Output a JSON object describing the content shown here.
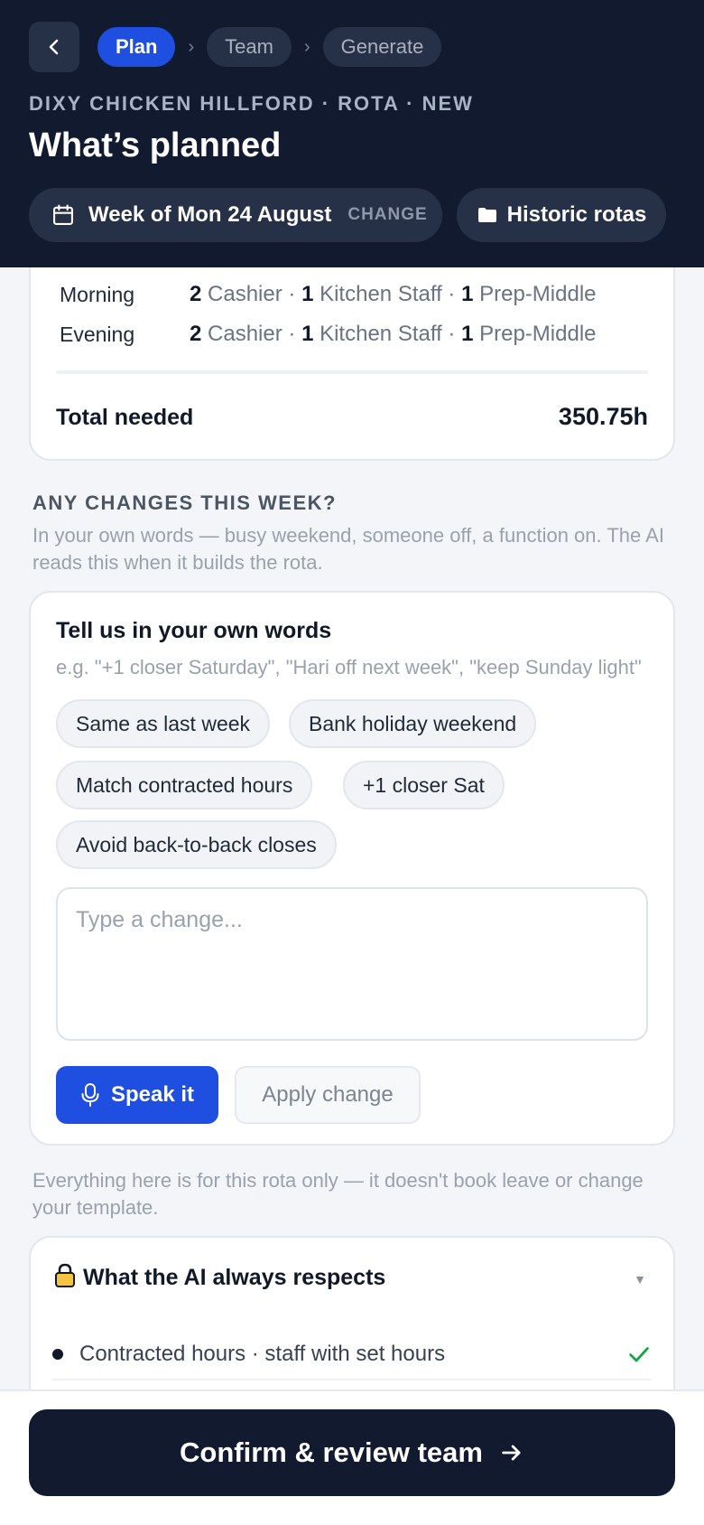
{
  "header": {
    "back_icon": "chevron-left-icon",
    "breadcrumbs": [
      {
        "label": "Plan",
        "active": true
      },
      {
        "label": "Team",
        "active": false
      },
      {
        "label": "Generate",
        "active": false
      }
    ],
    "eyebrow": "DIXY CHICKEN HILLFORD · ROTA · NEW",
    "title": "What’s planned",
    "week_label": "Week of Mon 24 August",
    "week_change": "CHANGE",
    "historic_label": "Historic rotas"
  },
  "shifts": {
    "rows": [
      {
        "name": "Morning",
        "roles": [
          {
            "count": "2",
            "role": "Cashier"
          },
          {
            "count": "1",
            "role": "Kitchen Staff"
          },
          {
            "count": "1",
            "role": "Prep-Middle"
          }
        ]
      },
      {
        "name": "Evening",
        "roles": [
          {
            "count": "2",
            "role": "Cashier"
          },
          {
            "count": "1",
            "role": "Kitchen Staff"
          },
          {
            "count": "1",
            "role": "Prep-Middle"
          }
        ]
      }
    ],
    "total_label": "Total needed",
    "total_value": "350.75h"
  },
  "changes": {
    "heading": "ANY CHANGES THIS WEEK?",
    "subtitle": "In your own words — busy weekend, someone off, a function on. The AI reads this when it builds the rota.",
    "card_title": "Tell us in your own words",
    "hint": "e.g. \"+1 closer Saturday\", \"Hari off next week\", \"keep Sunday light\"",
    "chips": [
      "Same as last week",
      "Bank holiday weekend",
      "Match contracted hours",
      "+1 closer Sat",
      "Avoid back-to-back closes"
    ],
    "input_value": "",
    "input_placeholder": "Type a change...",
    "speak_label": "Speak it",
    "apply_label": "Apply change",
    "footnote": "Everything here is for this rota only — it doesn't book leave or change your template."
  },
  "respects": {
    "title": "What the AI always respects",
    "items": [
      {
        "text": "Contracted hours · staff with set hours",
        "checked": true
      }
    ]
  },
  "footer": {
    "confirm_label": "Confirm & review team"
  },
  "colors": {
    "header_bg": "#111a2e",
    "accent": "#1f4fe0",
    "check": "#16a34a"
  }
}
